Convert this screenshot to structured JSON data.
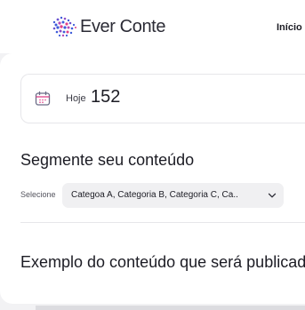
{
  "header": {
    "logo_text": "Ever Conte",
    "nav_link": "Início"
  },
  "today": {
    "label": "Hoje",
    "value": "152"
  },
  "segment": {
    "title": "Segmente seu conteúdo",
    "select_label": "Selecione",
    "select_value": "Categoa A, Categoria B, Categoria C, Ca.."
  },
  "example": {
    "title": "Exemplo do conteúdo que será publicado"
  },
  "colors": {
    "logo_primary": "#3d5bd9",
    "logo_secondary": "#e0418a",
    "calendar_accent": "#e0418a"
  },
  "icons": {
    "logo": "dots-cloud-logo-icon",
    "today": "calendar-icon",
    "select": "chevron-down-icon"
  }
}
